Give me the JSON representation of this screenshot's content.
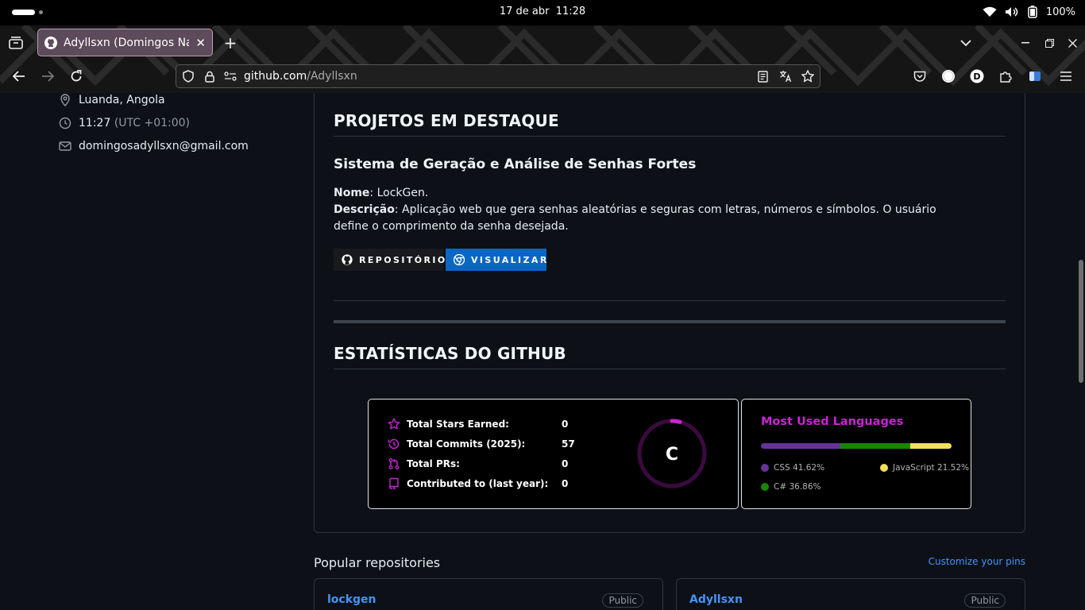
{
  "system_bar": {
    "date": "17 de abr",
    "time": "11:28",
    "battery": "100%"
  },
  "browser": {
    "tab_title": "Adyllsxn (Domingos Nascimento)",
    "url_host": "github.com",
    "url_path": "/Adyllsxn"
  },
  "profile": {
    "location": "Luanda, Angola",
    "local_time": "11:27",
    "utc_offset": "(UTC +01:00)",
    "email": "domingosadyllsxn@gmail.com"
  },
  "readme": {
    "projects_heading": "PROJETOS EM DESTAQUE",
    "project": {
      "title": "Sistema de Geração e Análise de Senhas Fortes",
      "name_label": "Nome",
      "name_value": ": LockGen.",
      "desc_label": "Descrição",
      "desc_value": ": Aplicação web que gera senhas aleatórias e seguras com letras, números e símbolos. O usuário define o comprimento da senha desejada.",
      "repo_button": "REPOSITÓRIO",
      "view_button": "VISUALIZAR"
    },
    "stats_heading": "ESTATÍSTICAS DO GITHUB",
    "stats": [
      {
        "label": "Total Stars Earned:",
        "value": "0",
        "icon": "star-icon"
      },
      {
        "label": "Total Commits (2025):",
        "value": "57",
        "icon": "history-icon"
      },
      {
        "label": "Total PRs:",
        "value": "0",
        "icon": "pull-request-icon"
      },
      {
        "label": "Contributed to (last year):",
        "value": "0",
        "icon": "repo-icon"
      }
    ],
    "rank": {
      "grade": "C",
      "progress_fraction": 0.04
    },
    "languages": {
      "title": "Most Used Languages",
      "items": [
        {
          "name": "CSS",
          "percent": "41.62%",
          "value": 41.62,
          "color": "#663399"
        },
        {
          "name": "C#",
          "percent": "36.86%",
          "value": 36.86,
          "color": "#178600"
        },
        {
          "name": "JavaScript",
          "percent": "21.52%",
          "value": 21.52,
          "color": "#f1e05a"
        }
      ]
    }
  },
  "popular": {
    "heading": "Popular repositories",
    "customize_link": "Customize your pins",
    "repos": [
      {
        "name": "lockgen",
        "visibility": "Public"
      },
      {
        "name": "Adyllsxn",
        "visibility": "Public"
      }
    ]
  },
  "colors": {
    "accent_pink": "#fe428e",
    "lang_title": "#c924d5",
    "link_blue": "#4493f8",
    "visualizar_blue": "#0a66c2"
  }
}
